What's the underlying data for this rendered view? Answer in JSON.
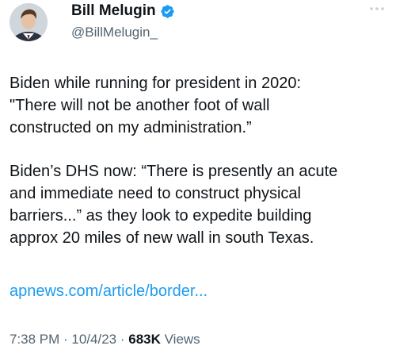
{
  "author": {
    "display_name": "Bill Melugin",
    "handle": "@BillMelugin_",
    "verified": true,
    "avatar_icon": "profile-photo"
  },
  "tweet": {
    "paragraphs": [
      "Biden while running for president in 2020:\n\"There will not be another foot of wall\nconstructed on my administration.”",
      "Biden’s DHS now: “There is presently an acute\nand immediate need to construct physical\nbarriers...” as they look to expedite building\napprox 20 miles of new wall in south Texas."
    ],
    "link_text": "apnews.com/article/border..."
  },
  "meta": {
    "time": "7:38 PM",
    "sep1": " · ",
    "date": "10/4/23",
    "sep2": " · ",
    "views_count": "683K",
    "views_label": " Views"
  },
  "colors": {
    "link": "#1d9bf0",
    "verified_badge": "#1d9bf0",
    "secondary_text": "#536471"
  }
}
